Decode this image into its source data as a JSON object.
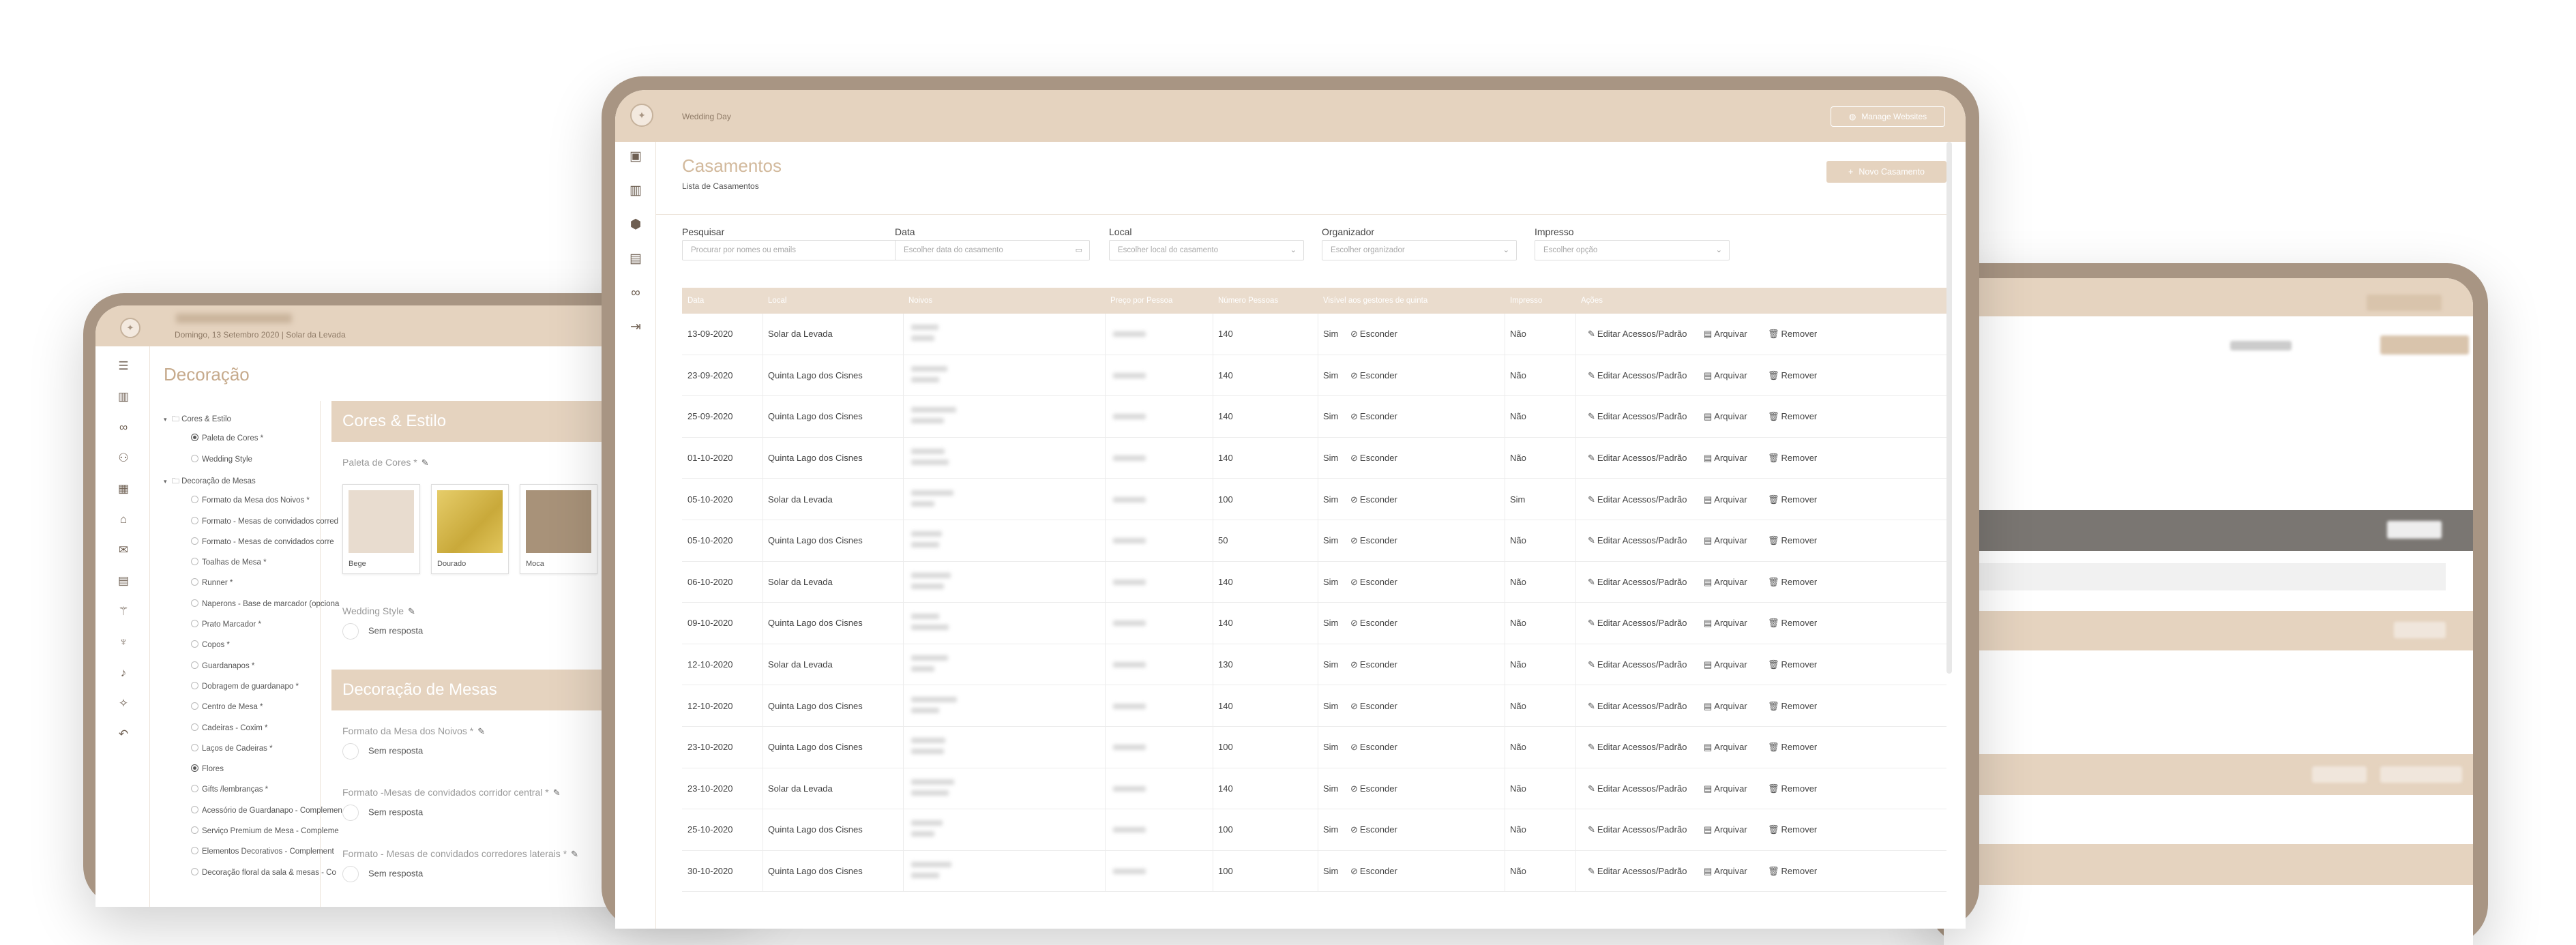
{
  "right_device": {},
  "left_device": {
    "header_date": "Domingo, 13 Setembro 2020  |  Solar da Levada",
    "logo_glyph": "✦",
    "page_title": "Decoração",
    "sidebar_icons": [
      "list-icon",
      "chart-icon",
      "rings-icon",
      "couple-icon",
      "calendar-icon",
      "lock-icon",
      "gift-icon",
      "building-icon",
      "cutlery-icon",
      "glass-icon",
      "mic-icon",
      "sparkle-icon",
      "undo-icon"
    ],
    "tree": [
      {
        "label": "Cores & Estilo",
        "level": 0,
        "toggle": "▾",
        "folder": true
      },
      {
        "label": "Paleta de Cores *",
        "level": 1,
        "checked": true
      },
      {
        "label": "Wedding Style",
        "level": 1,
        "checked": false
      },
      {
        "label": "Decoração de Mesas",
        "level": 0,
        "toggle": "▾",
        "folder": true
      },
      {
        "label": "Formato da Mesa dos Noivos *",
        "level": 1,
        "checked": false
      },
      {
        "label": "Formato - Mesas de convidados corred",
        "level": 1,
        "checked": false
      },
      {
        "label": "Formato - Mesas de convidados corre",
        "level": 1,
        "checked": false
      },
      {
        "label": "Toalhas de Mesa *",
        "level": 1,
        "checked": false
      },
      {
        "label": "Runner *",
        "level": 1,
        "checked": false
      },
      {
        "label": "Naperons - Base de marcador (opciona",
        "level": 1,
        "checked": false
      },
      {
        "label": "Prato Marcador *",
        "level": 1,
        "checked": false
      },
      {
        "label": "Copos *",
        "level": 1,
        "checked": false
      },
      {
        "label": "Guardanapos *",
        "level": 1,
        "checked": false
      },
      {
        "label": "Dobragem de guardanapo *",
        "level": 1,
        "checked": false
      },
      {
        "label": "Centro de Mesa *",
        "level": 1,
        "checked": false
      },
      {
        "label": "Cadeiras - Coxim *",
        "level": 1,
        "checked": false
      },
      {
        "label": "Laços de Cadeiras *",
        "level": 1,
        "checked": false
      },
      {
        "label": "Flores",
        "level": 1,
        "checked": true
      },
      {
        "label": "Gifts /lembranças *",
        "level": 1,
        "checked": false
      },
      {
        "label": "Acessório de Guardanapo - Complemen",
        "level": 1,
        "checked": false
      },
      {
        "label": "Serviço Premium de Mesa - Compleme",
        "level": 1,
        "checked": false
      },
      {
        "label": "Elementos Decorativos - Complement",
        "level": 1,
        "checked": false
      },
      {
        "label": "Decoração floral da sala & mesas - Co",
        "level": 1,
        "checked": false
      }
    ],
    "section1_title": "Cores & Estilo",
    "paleta_label": "Paleta de Cores *",
    "swatches": [
      {
        "name": "Bege",
        "color": "#e8dccf"
      },
      {
        "name": "Dourado",
        "color": "#d9b94a"
      },
      {
        "name": "Moca",
        "color": "#a89279"
      }
    ],
    "wedding_style_label": "Wedding Style",
    "sem_resposta": "Sem resposta",
    "section2_title": "Decoração de Mesas",
    "fields": [
      "Formato da Mesa dos Noivos *",
      "Formato -Mesas de convidados corridor central *",
      "Formato - Mesas de convidados corredores laterais *"
    ],
    "pen_glyph": "✎"
  },
  "center_device": {
    "app_name": "Wedding Day",
    "manage_websites": "Manage Websites",
    "globe_glyph": "◍",
    "page_title": "Casamentos",
    "page_subtitle": "Lista de Casamentos",
    "new_button": "Novo Casamento",
    "plus_glyph": "+",
    "sidebar_icons": [
      "monitor-icon",
      "chart-icon",
      "package-icon",
      "ledger-icon",
      "rings-icon",
      "logout-icon"
    ],
    "filters": [
      {
        "label": "Pesquisar",
        "placeholder": "Procurar por nomes ou emails",
        "caret": ""
      },
      {
        "label": "Data",
        "placeholder": "Escolher data do casamento",
        "caret": "▭"
      },
      {
        "label": "Local",
        "placeholder": "Escolher local do casamento",
        "caret": "⌄"
      },
      {
        "label": "Organizador",
        "placeholder": "Escolher organizador",
        "caret": "⌄"
      },
      {
        "label": "Impresso",
        "placeholder": "Escolher opção",
        "caret": "⌄"
      }
    ],
    "columns": [
      "Data",
      "Local",
      "Noivos",
      "Preço por Pessoa",
      "Número Pessoas",
      "Visível aos gestores de quinta",
      "Impresso",
      "Ações"
    ],
    "rows": [
      {
        "date": "13-09-2020",
        "local": "Solar da Levada",
        "pessoas": "140",
        "visivel": "Sim",
        "impresso": "Não"
      },
      {
        "date": "23-09-2020",
        "local": "Quinta Lago dos Cisnes",
        "pessoas": "140",
        "visivel": "Sim",
        "impresso": "Não"
      },
      {
        "date": "25-09-2020",
        "local": "Quinta Lago dos Cisnes",
        "pessoas": "140",
        "visivel": "Sim",
        "impresso": "Não"
      },
      {
        "date": "01-10-2020",
        "local": "Quinta Lago dos Cisnes",
        "pessoas": "140",
        "visivel": "Sim",
        "impresso": "Não"
      },
      {
        "date": "05-10-2020",
        "local": "Solar da Levada",
        "pessoas": "100",
        "visivel": "Sim",
        "impresso": "Sim"
      },
      {
        "date": "05-10-2020",
        "local": "Quinta Lago dos Cisnes",
        "pessoas": "50",
        "visivel": "Sim",
        "impresso": "Não"
      },
      {
        "date": "06-10-2020",
        "local": "Solar da Levada",
        "pessoas": "140",
        "visivel": "Sim",
        "impresso": "Não"
      },
      {
        "date": "09-10-2020",
        "local": "Quinta Lago dos Cisnes",
        "pessoas": "140",
        "visivel": "Sim",
        "impresso": "Não"
      },
      {
        "date": "12-10-2020",
        "local": "Solar da Levada",
        "pessoas": "130",
        "visivel": "Sim",
        "impresso": "Não"
      },
      {
        "date": "12-10-2020",
        "local": "Quinta Lago dos Cisnes",
        "pessoas": "140",
        "visivel": "Sim",
        "impresso": "Não"
      },
      {
        "date": "23-10-2020",
        "local": "Quinta Lago dos Cisnes",
        "pessoas": "100",
        "visivel": "Sim",
        "impresso": "Não"
      },
      {
        "date": "23-10-2020",
        "local": "Solar da Levada",
        "pessoas": "140",
        "visivel": "Sim",
        "impresso": "Não"
      },
      {
        "date": "25-10-2020",
        "local": "Quinta Lago dos Cisnes",
        "pessoas": "100",
        "visivel": "Sim",
        "impresso": "Não"
      },
      {
        "date": "30-10-2020",
        "local": "Quinta Lago dos Cisnes",
        "pessoas": "100",
        "visivel": "Sim",
        "impresso": "Não"
      }
    ],
    "actions": {
      "esconder": "Esconder",
      "editar": "Editar Acessos/Padrão",
      "arquivar": "Arquivar",
      "remover": "Remover"
    },
    "icons": {
      "esconder": "⊘",
      "editar": "✎",
      "arquivar": "▤",
      "remover": "🗑"
    }
  },
  "colors": {
    "accent": "#e5d3bf",
    "frame": "#a89583",
    "title": "#d2b99c"
  }
}
